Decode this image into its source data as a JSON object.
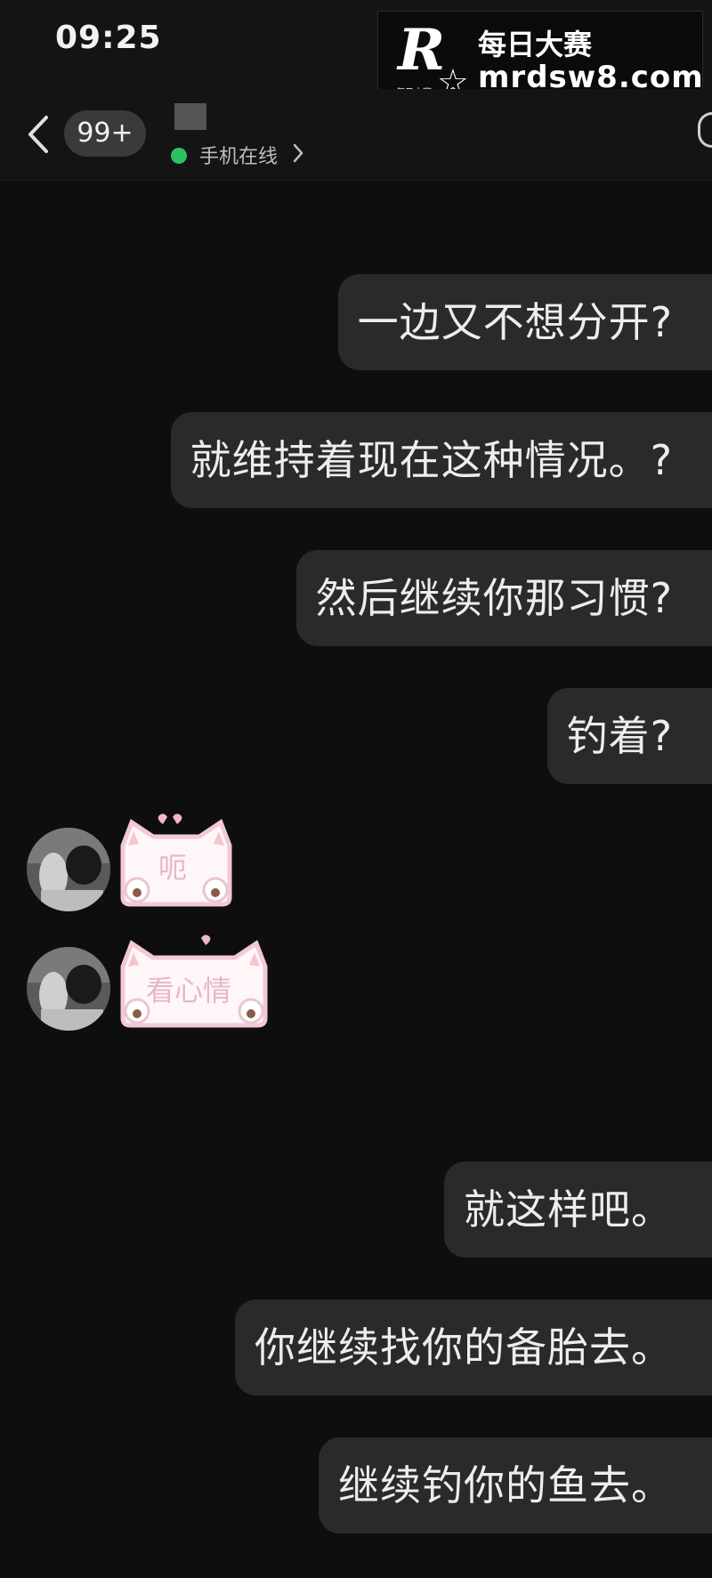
{
  "status_bar": {
    "time": "09:25"
  },
  "watermark": {
    "logo_letter": "R",
    "logo_small_text": "每日大赛",
    "title": "每日大赛",
    "url": "mrdsw8.com"
  },
  "nav": {
    "unread_count": "99+",
    "online_status": "手机在线"
  },
  "messages": [
    {
      "side": "right",
      "text": "一边又不想分开?"
    },
    {
      "side": "right",
      "text": "就维持着现在这种情况。?"
    },
    {
      "side": "right",
      "text": "然后继续你那习惯?"
    },
    {
      "side": "right",
      "text": "钓着?"
    },
    {
      "side": "left",
      "type": "sticker",
      "text": "呃"
    },
    {
      "side": "left",
      "type": "sticker",
      "text": "看心情"
    },
    {
      "side": "right",
      "text": "就这样吧。"
    },
    {
      "side": "right",
      "text": "你继续找你的备胎去。"
    },
    {
      "side": "right",
      "text": "继续钓你的鱼去。"
    }
  ],
  "colors": {
    "background": "#0e0e10",
    "bubble": "#2a2a2c",
    "online": "#2dc25f",
    "sticker_pink": "#f3c9d3"
  }
}
